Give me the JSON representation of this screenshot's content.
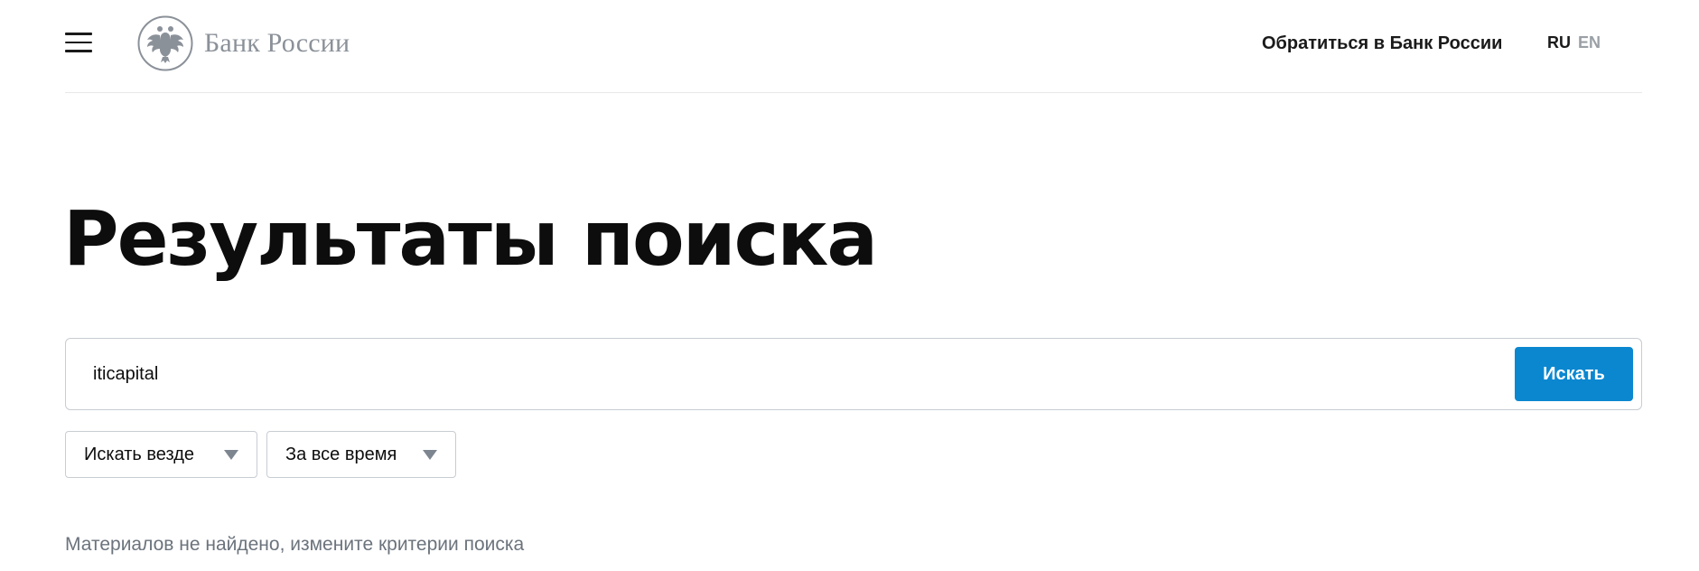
{
  "header": {
    "logo_text": "Банк России",
    "contact_link": "Обратиться в Банк России",
    "languages": [
      {
        "code": "RU",
        "active": true
      },
      {
        "code": "EN",
        "active": false
      }
    ]
  },
  "page": {
    "title": "Результаты поиска"
  },
  "search": {
    "value": "iticapital",
    "button_label": "Искать"
  },
  "filters": {
    "where": {
      "selected": "Искать везде"
    },
    "period": {
      "selected": "За все время"
    }
  },
  "results": {
    "empty_message": "Материалов не найдено, измените критерии поиска"
  },
  "colors": {
    "accent": "#0b87d0",
    "muted_text": "#6b737c",
    "logo_gray": "#8b9199"
  },
  "icons": [
    "menu-icon",
    "emblem-icon",
    "dropdown-arrow-icon"
  ]
}
